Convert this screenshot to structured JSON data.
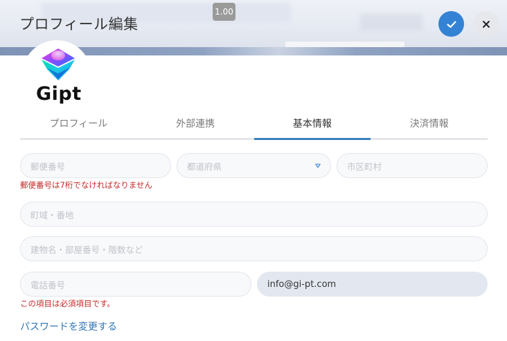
{
  "header": {
    "title": "プロフィール編集",
    "zoom": "1.00",
    "confirm_icon": "check-icon",
    "close_icon": "close-icon"
  },
  "logo": {
    "text": "Gipt",
    "icon": "gipt-logo-mark"
  },
  "tabs": [
    {
      "label": "プロフィール",
      "active": false
    },
    {
      "label": "外部連携",
      "active": false
    },
    {
      "label": "基本情報",
      "active": true
    },
    {
      "label": "決済情報",
      "active": false
    }
  ],
  "form": {
    "postal_code": {
      "placeholder": "郵便番号",
      "value": ""
    },
    "prefecture": {
      "placeholder": "都道府県",
      "value": ""
    },
    "city": {
      "placeholder": "市区町村",
      "value": ""
    },
    "postal_error": "郵便番号は7桁でなければなりません",
    "street": {
      "placeholder": "町域・番地",
      "value": ""
    },
    "building": {
      "placeholder": "建物名・部屋番号・階数など",
      "value": ""
    },
    "phone": {
      "placeholder": "電話番号",
      "value": ""
    },
    "email": {
      "placeholder": "",
      "value": "info@gi-pt.com"
    },
    "phone_error": "この項目は必須項目です。"
  },
  "password_link": "パスワードを変更する",
  "colors": {
    "accent": "#3482d4",
    "tab_underline": "#3b7fc1",
    "error": "#c62828",
    "link": "#2f75b5"
  }
}
